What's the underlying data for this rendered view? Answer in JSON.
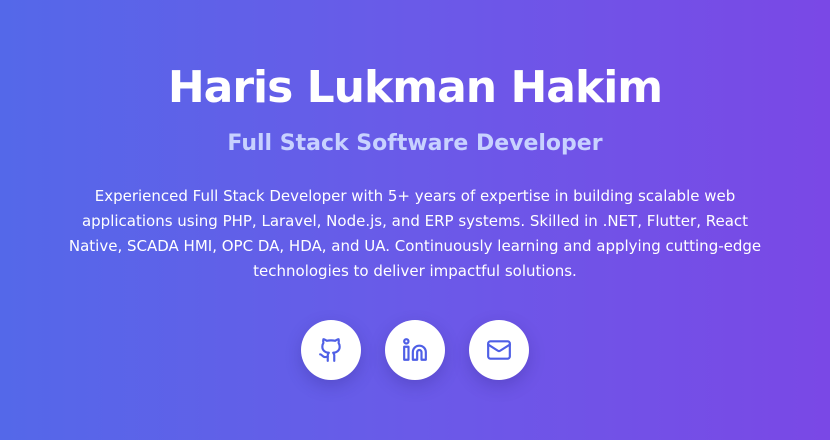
{
  "profile": {
    "name": "Haris Lukman Hakim",
    "role": "Full Stack Software Developer",
    "bio": "Experienced Full Stack Developer with 5+ years of expertise in building scalable web applications using PHP, Laravel, Node.js, and ERP systems. Skilled in .NET, Flutter, React Native, SCADA HMI, OPC DA, HDA, and UA. Continuously learning and applying cutting-edge technologies to deliver impactful solutions."
  },
  "socials": [
    {
      "icon": "github-icon"
    },
    {
      "icon": "linkedin-icon"
    },
    {
      "icon": "mail-icon"
    }
  ],
  "colors": {
    "gradient_start": "#5468e9",
    "gradient_end": "#7a48e6",
    "icon_color": "#4f5fe6",
    "role_color": "#c8d2ff"
  }
}
